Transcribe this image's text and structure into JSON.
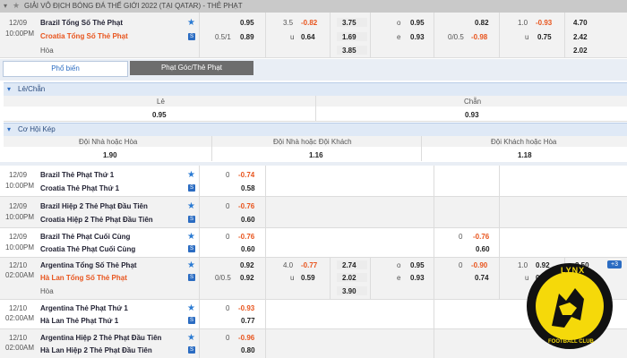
{
  "header": {
    "title": "GIẢI VÔ ĐỊCH BÓNG ĐÁ THẾ GIỚI 2022 (TẠI QATAR) - THẺ PHẠT"
  },
  "tabs": [
    {
      "label": "Phổ biến"
    },
    {
      "label": "Phạt Góc/Thẻ Phạt"
    }
  ],
  "row1": {
    "date": "12/09",
    "time": "10:00PM",
    "home": "Brazil Tổng Số Thẻ Phạt",
    "away": "Croatia Tổng Số Thẻ Phạt",
    "draw": "Hòa",
    "c1a": "0.95",
    "c1b": "0.89",
    "hcp": "0.5/1",
    "ou": "3.5",
    "ou_a": "-0.82",
    "ou_b": "0.64",
    "u": "u",
    "x1": "3.75",
    "x2": "1.69",
    "x3": "3.85",
    "o1": "o",
    "o2": "e",
    "v1": "0.95",
    "v2": "0.93",
    "h2a": "0.82",
    "h2hcp": "0/0.5",
    "h2b": "-0.98",
    "ou2": "1.0",
    "ou2a": "-0.93",
    "u2": "u",
    "ou2b": "0.75",
    "y1": "4.70",
    "y2": "2.42",
    "y3": "2.02"
  },
  "sections": {
    "odd_even": "Lẻ/Chẵn",
    "odd": "Lẻ",
    "even": "Chẵn",
    "odd_v": "0.95",
    "even_v": "0.93",
    "double": "Cơ Hội Kép",
    "dc1": "Đội Nhà hoặc Hòa",
    "dc2": "Đội Nhà hoặc Đội Khách",
    "dc3": "Đội Khách hoặc Hòa",
    "dc1v": "1.90",
    "dc2v": "1.16",
    "dc3v": "1.18"
  },
  "matches": [
    {
      "date": "12/09",
      "time": "10:00PM",
      "home": "Brazil Thẻ Phạt Thứ 1",
      "away": "Croatia Thẻ Phạt Thứ 1",
      "hcp": "0",
      "a": "-0.74",
      "b": "0.58"
    },
    {
      "date": "12/09",
      "time": "10:00PM",
      "home": "Brazil Hiệp 2 Thẻ Phạt Đầu Tiên",
      "away": "Croatia Hiệp 2 Thẻ Phạt Đầu Tiên",
      "hcp": "0",
      "a": "-0.76",
      "b": "0.60"
    },
    {
      "date": "12/09",
      "time": "10:00PM",
      "home": "Brazil Thẻ Phạt Cuối Cùng",
      "away": "Croatia Thẻ Phạt Cuối Cùng",
      "hcp": "0",
      "a": "-0.76",
      "b": "0.60",
      "hcp2": "0",
      "a2": "-0.76",
      "b2": "0.60"
    }
  ],
  "row5": {
    "date": "12/10",
    "time": "02:00AM",
    "home": "Argentina Tổng Số Thẻ Phạt",
    "away": "Hà Lan Tổng Số Thẻ Phạt",
    "draw": "Hòa",
    "c1a": "0.92",
    "hcp": "0/0.5",
    "c1b": "0.92",
    "ou": "4.0",
    "ou_a": "-0.77",
    "u": "u",
    "ou_b": "0.59",
    "x1": "2.74",
    "x2": "2.02",
    "x3": "3.90",
    "o1": "o",
    "o2": "e",
    "v1": "0.95",
    "v2": "0.93",
    "h2hcp": "0",
    "h2a": "-0.90",
    "h2b": "0.74",
    "ou2": "1.0",
    "ou2a": "0.92",
    "u2": "u",
    "ou2b": "0.74",
    "y1": "3.50",
    "more": "+3"
  },
  "matches2": [
    {
      "date": "12/10",
      "time": "02:00AM",
      "home": "Argentina Thẻ Phạt Thứ 1",
      "away": "Hà Lan Thẻ Phạt Thứ 1",
      "hcp": "0",
      "a": "-0.93",
      "b": "0.77"
    },
    {
      "date": "12/10",
      "time": "02:00AM",
      "home": "Argentina Hiệp 2 Thẻ Phạt Đầu Tiên",
      "away": "Hà Lan Hiệp 2 Thẻ Phạt Đầu Tiên",
      "hcp": "0",
      "a": "-0.96",
      "b": "0.80"
    }
  ],
  "logo": {
    "text": "LYNX",
    "sub": "FOOTBALL CLUB",
    "colors": {
      "ring": "#111111",
      "fill": "#f5d90a"
    }
  },
  "icons": [
    "star-icon",
    "stats-icon",
    "chevron-down-icon"
  ]
}
